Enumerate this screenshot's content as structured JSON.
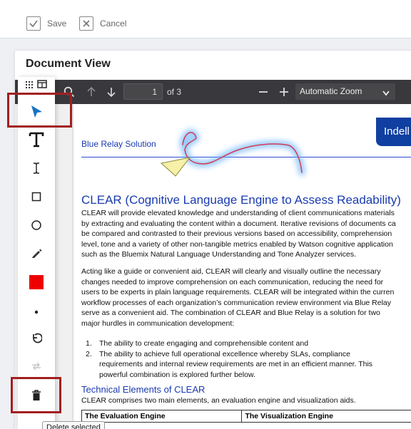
{
  "actions": {
    "save_label": "Save",
    "cancel_label": "Cancel"
  },
  "card": {
    "title": "Document View"
  },
  "viewer": {
    "page_current": "1",
    "page_of": "of 3",
    "zoom_value": "Automatic Zoom",
    "toolbar_icons": [
      "search-icon",
      "arrow-up-icon",
      "arrow-down-icon",
      "zoom-out-icon",
      "zoom-in-icon"
    ]
  },
  "annotation_tools": {
    "items": [
      "select-tool",
      "text-tool",
      "text-cursor-tool",
      "rectangle-tool",
      "ellipse-tool",
      "pen-tool",
      "color-swatch",
      "point-tool",
      "undo-tool",
      "redo-tool",
      "delete-tool"
    ],
    "color": "#ee0000",
    "selected": "select-tool",
    "tooltip": "Delete selected"
  },
  "document": {
    "logo_text": "Indell",
    "brand": "Blue Relay Solution",
    "heading": "CLEAR (Cognitive Language Engine to Assess Readability)",
    "para1": [
      "CLEAR will provide elevated knowledge and understanding of client communications materials",
      "by extracting and evaluating the content within a document. Iterative revisions of documents ca",
      "be compared and contrasted to their previous versions based on accessibility, comprehension",
      "level, tone and a variety of other non-tangible metrics enabled by Watson cognitive application",
      "such as the Bluemix Natural Language Understanding and Tone Analyzer services."
    ],
    "para2": [
      "Acting like a guide or convenient aid, CLEAR will clearly and visually outline the necessary",
      "changes needed to improve comprehension on each communication, reducing the need for",
      "users to be experts in plain language requirements. CLEAR will be integrated within the curren",
      "workflow processes of each organization’s communication review environment via Blue Relay",
      "serve as a convenient aid. The combination of CLEAR and Blue Relay is a solution for two",
      "major hurdles in communication development:"
    ],
    "list": [
      {
        "num": "1.",
        "lines": [
          "The ability to create engaging and comprehensible content and"
        ]
      },
      {
        "num": "2.",
        "lines": [
          "The ability to achieve full operational excellence whereby SLAs, compliance",
          "requirements and internal review requirements are met in an efficient manner. This",
          "powerful combination is explored further below."
        ]
      }
    ],
    "subheading": "Technical Elements of CLEAR",
    "para3": "CLEAR comprises two main elements, an evaluation engine and visualization aids.",
    "table_headers": [
      "The Evaluation Engine",
      "The Visualization Engine"
    ]
  },
  "colors": {
    "accent": "#1a3bb0",
    "highlight": "#a21f1f",
    "ink": "#d23b52",
    "ink_glow": "#6fb6ff",
    "pointer": "#f6f0a8"
  }
}
